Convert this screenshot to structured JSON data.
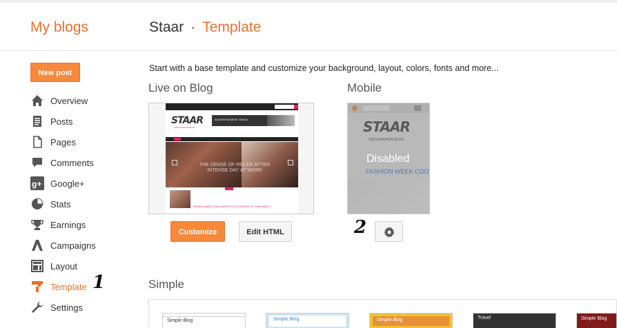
{
  "header": {
    "my_blogs": "My blogs",
    "blog_name": "Staar",
    "separator": "·",
    "current_page": "Template"
  },
  "sidebar": {
    "new_post": "New post",
    "items": [
      {
        "label": "Overview",
        "icon": "home-icon"
      },
      {
        "label": "Posts",
        "icon": "posts-icon"
      },
      {
        "label": "Pages",
        "icon": "pages-icon"
      },
      {
        "label": "Comments",
        "icon": "comment-icon"
      },
      {
        "label": "Google+",
        "icon": "google-plus-icon"
      },
      {
        "label": "Stats",
        "icon": "pie-chart-icon"
      },
      {
        "label": "Earnings",
        "icon": "trophy-icon"
      },
      {
        "label": "Campaigns",
        "icon": "campaigns-icon"
      },
      {
        "label": "Layout",
        "icon": "layout-icon"
      },
      {
        "label": "Template",
        "icon": "template-icon",
        "active": true
      },
      {
        "label": "Settings",
        "icon": "wrench-icon"
      }
    ]
  },
  "annotations": {
    "one": "1",
    "two": "2"
  },
  "main": {
    "intro": "Start with a base template and customize your background, layout, colors, fonts and more...",
    "live_title": "Live on Blog",
    "mobile_title": "Mobile",
    "customize": "Customize",
    "edit_html": "Edit HTML",
    "mobile_status": "Disabled",
    "simple_title": "Simple"
  },
  "live_preview": {
    "logo": "STAAR",
    "tagline": "100% FASHION BLOG",
    "ad_text": "ADVERTISEMENT SPACE",
    "slide_text": "THE SENSE OF RELIEF AFTER INTENSE DAY AT WORK",
    "post_title": "FASHION WEEK COOL HAIRSTYLES YOU NEED TO THINK ABOUT"
  },
  "mobile_preview": {
    "logo": "STAAR",
    "tagline": "100% FASHION BLOG",
    "post_title": "FASHION WEEK COO"
  },
  "simple_thumbs": [
    {
      "label": "Simple Blog"
    },
    {
      "label": "Simple Blog"
    },
    {
      "label": "Simple Blog"
    },
    {
      "label": "Travel"
    },
    {
      "label": "Simple Blog"
    }
  ],
  "colors": {
    "accent": "#e8712e",
    "button": "#f6893b"
  }
}
